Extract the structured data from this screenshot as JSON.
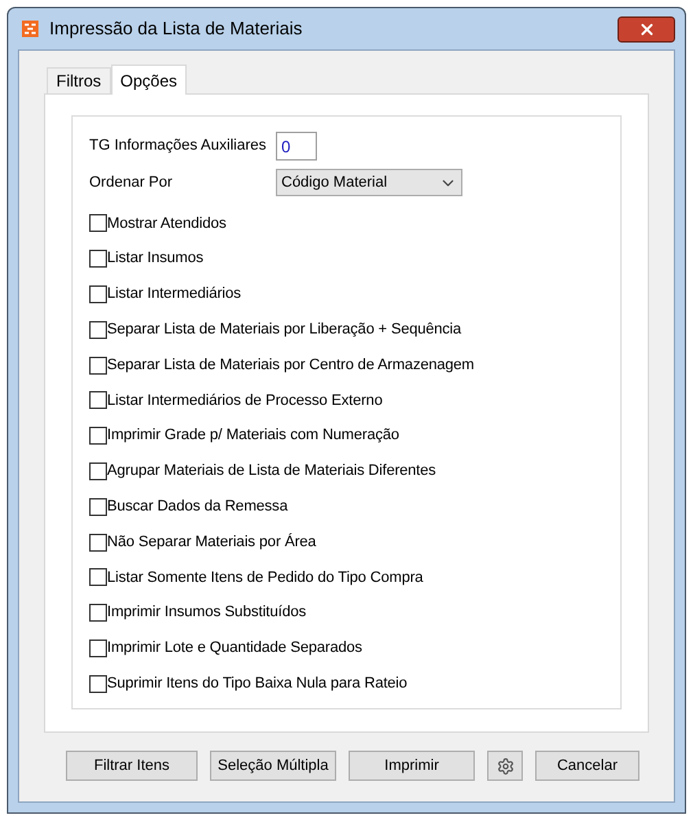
{
  "window": {
    "title": "Impressão da Lista de Materiais"
  },
  "tabs": [
    {
      "label": "Filtros",
      "selected": false
    },
    {
      "label": "Opções",
      "selected": true
    }
  ],
  "fields": {
    "tg_label": "TG Informações Auxiliares",
    "tg_value": "0",
    "order_label": "Ordenar Por",
    "order_value": "Código Material"
  },
  "options": [
    {
      "label": "Mostrar Atendidos",
      "checked": false
    },
    {
      "label": "Listar Insumos",
      "checked": false
    },
    {
      "label": "Listar Intermediários",
      "checked": false
    },
    {
      "label": "Separar Lista de Materiais por Liberação + Sequência",
      "checked": false
    },
    {
      "label": "Separar Lista de Materiais por Centro de Armazenagem",
      "checked": false
    },
    {
      "label": "Listar Intermediários de Processo Externo",
      "checked": false
    },
    {
      "label": "Imprimir Grade p/ Materiais com Numeração",
      "checked": false
    },
    {
      "label": "Agrupar Materiais de Lista de Materiais Diferentes",
      "checked": false
    },
    {
      "label": "Buscar Dados da Remessa",
      "checked": false
    },
    {
      "label": "Não Separar Materiais por Área",
      "checked": false
    },
    {
      "label": "Listar Somente Itens de Pedido do Tipo Compra",
      "checked": false
    },
    {
      "label": "Imprimir Insumos Substituídos",
      "checked": false
    },
    {
      "label": "Imprimir Lote e Quantidade Separados",
      "checked": false
    },
    {
      "label": "Suprimir Itens do Tipo Baixa Nula para Rateio",
      "checked": false
    }
  ],
  "buttons": [
    {
      "kind": "text",
      "label": "Filtrar Itens"
    },
    {
      "kind": "text",
      "label": "Seleção Múltipla"
    },
    {
      "kind": "text",
      "label": "Imprimir"
    },
    {
      "kind": "gear"
    },
    {
      "kind": "text",
      "label": "Cancelar"
    }
  ]
}
